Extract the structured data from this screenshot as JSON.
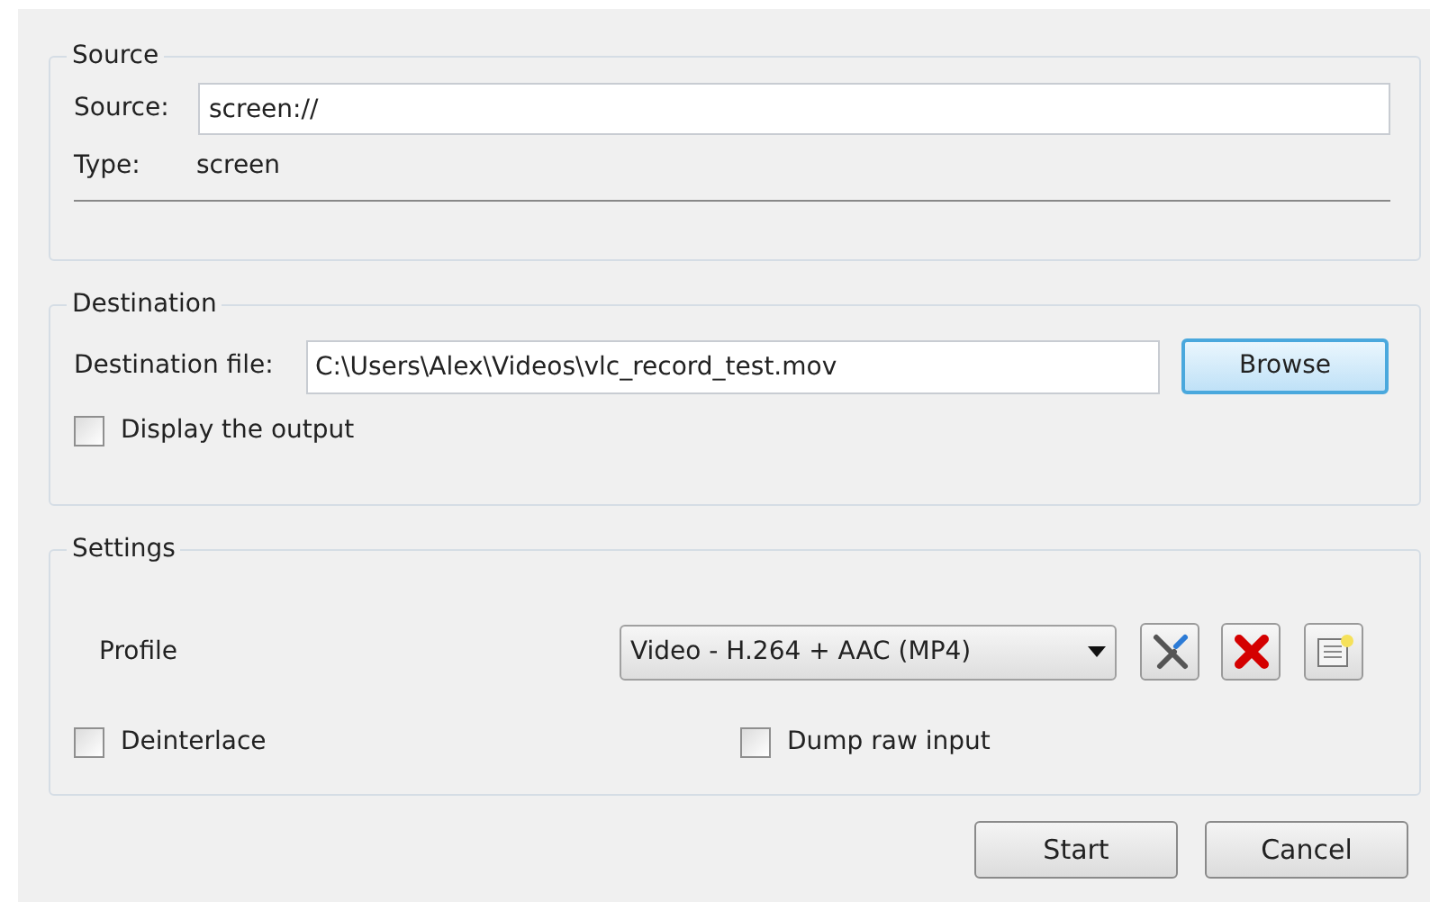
{
  "source": {
    "title": "Source",
    "source_label": "Source:",
    "source_value": "screen://",
    "type_label": "Type:",
    "type_value": "screen"
  },
  "destination": {
    "title": "Destination",
    "file_label": "Destination file:",
    "file_value": "C:\\Users\\Alex\\Videos\\vlc_record_test.mov",
    "browse_button": "Browse",
    "display_output": {
      "label": "Display the output",
      "checked": false
    }
  },
  "settings": {
    "title": "Settings",
    "profile_label": "Profile",
    "profile_value": "Video - H.264 + AAC (MP4)",
    "deinterlace": {
      "label": "Deinterlace",
      "checked": false
    },
    "dump_raw_input": {
      "label": "Dump raw input",
      "checked": false
    }
  },
  "buttons": [
    "Start",
    "Cancel"
  ]
}
